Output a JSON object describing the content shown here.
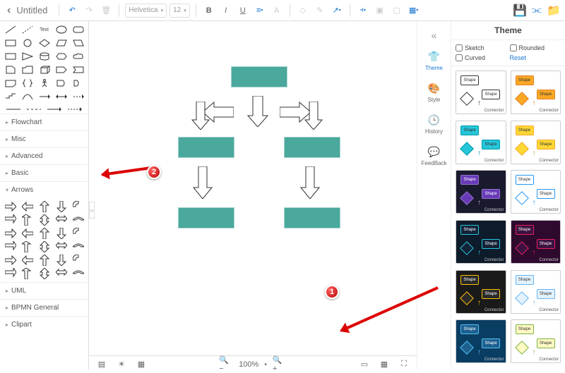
{
  "header": {
    "title": "Untitled",
    "font": "Helvetica",
    "font_size": "12"
  },
  "left": {
    "categories": [
      "Flowchart",
      "Misc",
      "Advanced",
      "Basic",
      "Arrows",
      "UML",
      "BPMN General",
      "Clipart"
    ]
  },
  "footer": {
    "zoom": "100%"
  },
  "rail": {
    "items": [
      "Theme",
      "Style",
      "History",
      "FeedBack"
    ]
  },
  "theme": {
    "title": "Theme",
    "opts": {
      "sketch": "Sketch",
      "rounded": "Rounded",
      "curved": "Curved",
      "reset": "Reset"
    },
    "shape_label": "Shape",
    "connector_label": "Connector",
    "cards": [
      {
        "bg": "#ffffff",
        "shape": "#fff",
        "border": "#333",
        "acc": "#333"
      },
      {
        "bg": "#ffffff",
        "shape": "#f9a825",
        "border": "#e67e22",
        "acc": "#e67e22"
      },
      {
        "bg": "#ffffff",
        "shape": "#26c6da",
        "border": "#0097a7",
        "acc": "#0097a7"
      },
      {
        "bg": "#ffffff",
        "shape": "#fdd835",
        "border": "#f9a825",
        "acc": "#c0a020"
      },
      {
        "bg": "#1a1a2e",
        "shape": "#673ab7",
        "border": "#9575cd",
        "acc": "#bbb"
      },
      {
        "bg": "#ffffff",
        "shape": "#fff",
        "border": "#2196f3",
        "acc": "#2196f3"
      },
      {
        "bg": "#0d1b2a",
        "shape": "#132238",
        "border": "#26c6da",
        "acc": "#26c6da"
      },
      {
        "bg": "#2d0a2e",
        "shape": "#3d1240",
        "border": "#e91e63",
        "acc": "#e91e63"
      },
      {
        "bg": "#1a1a1a",
        "shape": "#2a2a2a",
        "border": "#ffc107",
        "acc": "#ffc107"
      },
      {
        "bg": "#ffffff",
        "shape": "#e3f2fd",
        "border": "#64b5f6",
        "acc": "#64b5f6"
      },
      {
        "bg": "#0a3d62",
        "shape": "#1e5f8e",
        "border": "#4fc3f7",
        "acc": "#4fc3f7"
      },
      {
        "bg": "#ffffff",
        "shape": "#fff9c4",
        "border": "#7cb342",
        "acc": "#7cb342"
      }
    ]
  },
  "callouts": {
    "one": "1",
    "two": "2"
  }
}
